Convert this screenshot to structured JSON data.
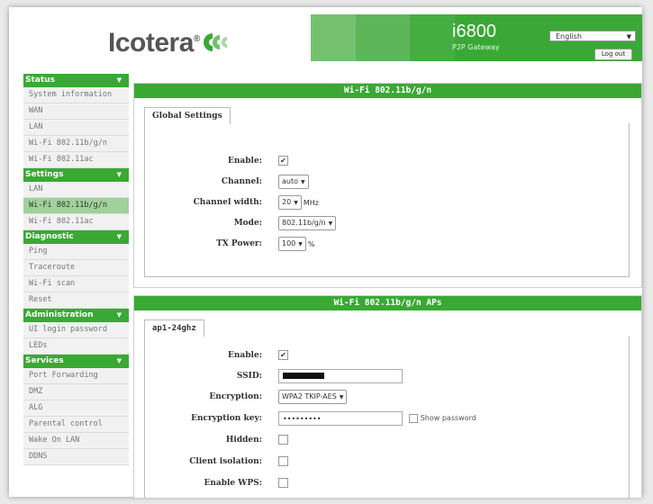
{
  "header": {
    "brand": "Icotera",
    "model": "i6800",
    "model_sub": "P2P Gateway",
    "language": "English",
    "logout_label": "Log out"
  },
  "sidebar": {
    "sections": [
      {
        "title": "Status",
        "items": [
          "System information",
          "WAN",
          "LAN",
          "Wi-Fi 802.11b/g/n",
          "Wi-Fi 802.11ac"
        ]
      },
      {
        "title": "Settings",
        "items": [
          "LAN",
          "Wi-Fi 802.11b/g/n",
          "Wi-Fi 802.11ac"
        ],
        "active_index": 1
      },
      {
        "title": "Diagnostic",
        "items": [
          "Ping",
          "Traceroute",
          "Wi-Fi scan",
          "Reset"
        ]
      },
      {
        "title": "Administration",
        "items": [
          "UI login password",
          "LEDs"
        ]
      },
      {
        "title": "Services",
        "items": [
          "Port Forwarding",
          "DMZ",
          "ALG",
          "Parental control",
          "Wake On LAN",
          "DDNS"
        ]
      }
    ]
  },
  "panel1": {
    "title": "Wi-Fi 802.11b/g/n",
    "tab": "Global Settings",
    "enable_label": "Enable:",
    "channel_label": "Channel:",
    "channel_value": "auto",
    "width_label": "Channel width:",
    "width_value": "20",
    "width_unit": "MHz",
    "mode_label": "Mode:",
    "mode_value": "802.11b/g/n",
    "tx_label": "TX Power:",
    "tx_value": "100",
    "tx_unit": "%"
  },
  "panel2": {
    "title": "Wi-Fi 802.11b/g/n APs",
    "tab": "ap1-24ghz",
    "enable_label": "Enable:",
    "ssid_label": "SSID:",
    "encryption_label": "Encryption:",
    "encryption_value": "WPA2 TKIP-AES",
    "key_label": "Encryption key:",
    "key_value": "•••••••••",
    "show_password": "Show password",
    "hidden_label": "Hidden:",
    "isolation_label": "Client isolation:",
    "wps_label": "Enable WPS:"
  },
  "colors": {
    "accent": "#39a934",
    "active_item": "#9fd29a"
  }
}
